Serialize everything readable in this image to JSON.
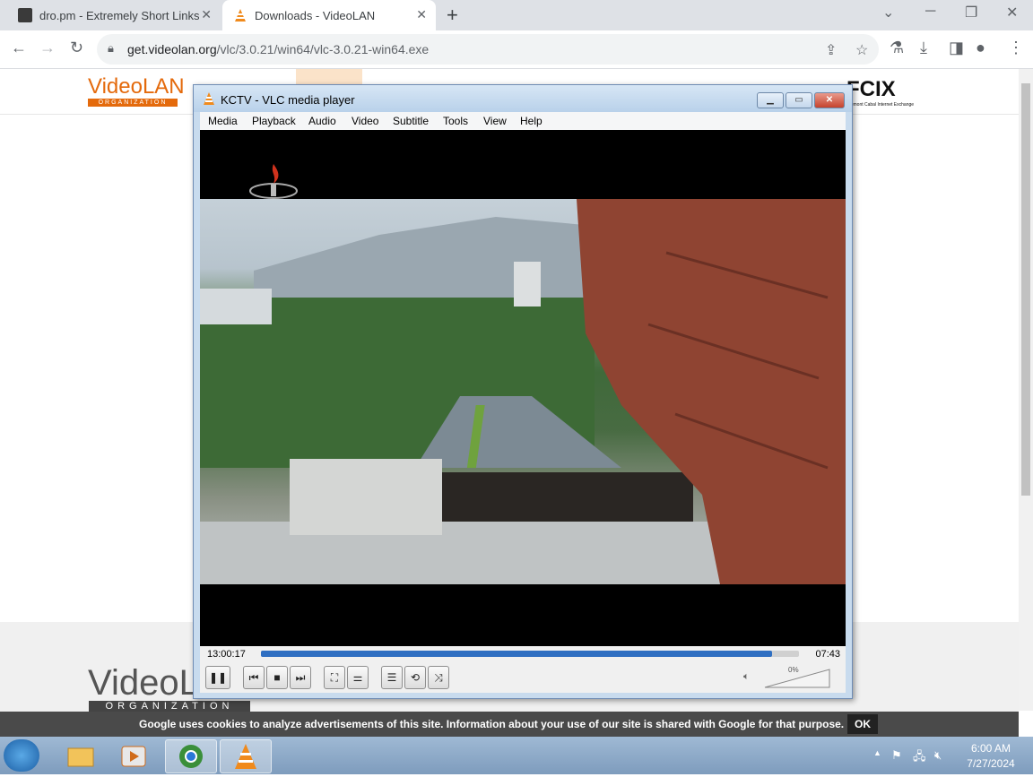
{
  "browser": {
    "tabs": [
      {
        "title": "dro.pm - Extremely Short Links"
      },
      {
        "title": "Downloads - VideoLAN"
      }
    ],
    "url_host": "get.videolan.org",
    "url_path": "/vlc/3.0.21/win64/vlc-3.0.21-win64.exe"
  },
  "page": {
    "logo_text": "VideoLAN",
    "logo_org": "ORGANIZATION",
    "partner_logo": "FCIX",
    "partner_sub": "Fremont Cabal Internet Exchange",
    "footer_logo": "VideoLAN",
    "footer_org": "ORGANIZATION",
    "cookie_message": "Google uses cookies to analyze advertisements of this site. Information about your use of our site is shared with Google for that purpose.",
    "cookie_ok": "OK"
  },
  "vlc": {
    "title": "KCTV - VLC media player",
    "menu": [
      "Media",
      "Playback",
      "Audio",
      "Video",
      "Subtitle",
      "Tools",
      "View",
      "Help"
    ],
    "time_elapsed": "13:00:17",
    "time_remaining": "07:43",
    "seek_fraction": 0.95,
    "volume": "0%"
  },
  "taskbar": {
    "clock_time": "6:00 AM",
    "clock_date": "7/27/2024"
  },
  "colors": {
    "videolan_orange": "#e46a0c",
    "seek_blue": "#2f6fc2"
  }
}
